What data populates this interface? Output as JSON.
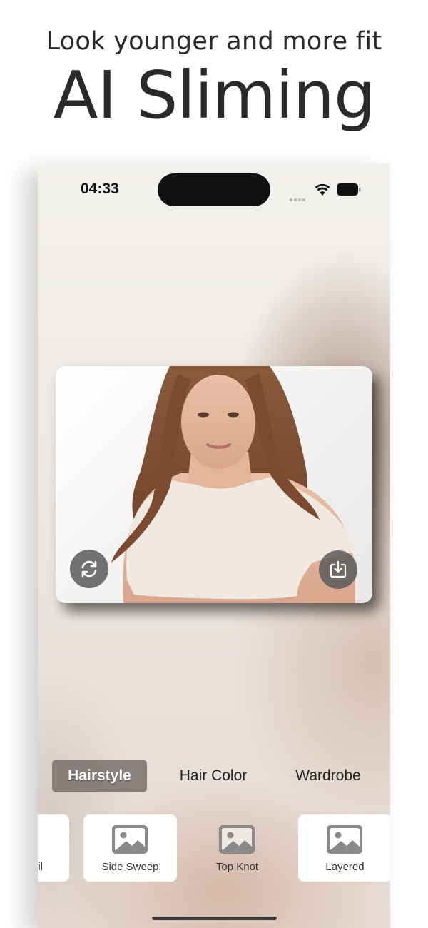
{
  "promo": {
    "subtitle": "Look younger and more fit",
    "title": "AI Sliming"
  },
  "status_bar": {
    "time": "04:33"
  },
  "photo": {
    "refresh_icon": "refresh-icon",
    "download_icon": "download-icon"
  },
  "tabs": [
    {
      "label": "Hairstyle",
      "active": true
    },
    {
      "label": "Hair Color",
      "active": false
    },
    {
      "label": "Wardrobe",
      "active": false
    }
  ],
  "options": [
    {
      "label": "il",
      "icon": "image-icon"
    },
    {
      "label": "Side Sweep",
      "icon": "image-icon"
    },
    {
      "label": "Top Knot",
      "icon": "image-icon"
    },
    {
      "label": "Layered",
      "icon": "image-icon"
    }
  ],
  "colors": {
    "active_tab": "#7a716d",
    "placeholder_icon": "#8a8a8a",
    "button_bg": "#5a5a5a"
  }
}
